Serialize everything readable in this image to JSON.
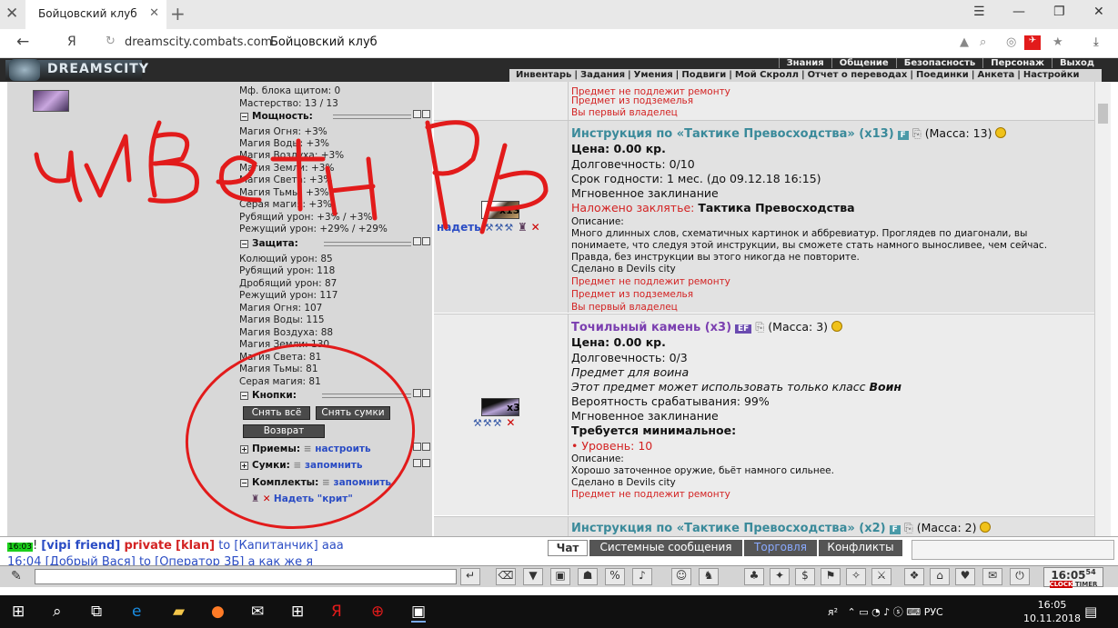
{
  "browser": {
    "tab_title": "Бойцовский клуб",
    "url_host": "dreamscity.combats.com",
    "page_title": "Бойцовский клуб",
    "yandex_letter": "Я"
  },
  "game": {
    "logo": "DREAMSCITY",
    "top_menu": [
      "Знания",
      "Общение",
      "Безопасность",
      "Персонаж",
      "Выход"
    ],
    "sub_menu": [
      "Инвентарь",
      "Задания",
      "Умения",
      "Подвиги",
      "Мой Скролл",
      "Отчет о переводах",
      "Поединки",
      "Анкета",
      "Настройки"
    ]
  },
  "left": {
    "stats_top": [
      "Мф. блока щитом: 0",
      "Мастерство: 13 / 13"
    ],
    "power_header": "Мощность:",
    "power": [
      "Магия Огня: +3%",
      "Магия Воды: +3%",
      "Магия Воздуха: +3%",
      "Магия Земли: +3%",
      "Магия Света: +3%",
      "Магия Тьмы: +3%",
      "Серая магия: +3%",
      "Рубящий урон: +3% / +3%",
      "Режущий урон: +29% / +29%"
    ],
    "defense_header": "Защита:",
    "defense": [
      "Колющий урон: 85",
      "Рубящий урон: 118",
      "Дробящий урон: 87",
      "Режущий урон: 117",
      "Магия Огня: 107",
      "Магия Воды: 115",
      "Магия Воздуха: 88",
      "Магия Земли: 130",
      "Магия Света: 81",
      "Магия Тьмы: 81",
      "Серая магия: 81"
    ],
    "buttons_header": "Кнопки:",
    "btn_remove_all": "Снять всё",
    "btn_remove_bags": "Снять сумки",
    "btn_return": "Возврат",
    "techniques": "Приемы:",
    "bags": "Сумки:",
    "sets": "Комплекты:",
    "configure": "настроить",
    "remember": "запомнить",
    "remember2": "запомнить",
    "wear_set": "Надеть \"крит\""
  },
  "items": {
    "top_partial": [
      "Предмет не подлежит ремонту",
      "Предмет из подземелья",
      "Вы первый владелец"
    ],
    "item1": {
      "name": "Инструкция по «Тактике Превосходства» (x13)",
      "badge": "F",
      "mass": "(Масса: 13)",
      "count_label": "x13",
      "wear_link": "надеть",
      "lines": [
        "Цена: 0.00 кр.",
        "Долговечность: 0/10",
        "Срок годности: 1 мес. (до 09.12.18 16:15)",
        "Мгновенное заклинание"
      ],
      "spell_label": "Наложено заклятье:",
      "spell_value": "Тактика Превосходства",
      "desc_label": "Описание:",
      "desc": [
        "Много длинных слов, схематичных картинок и аббревиатур. Проглядев по диагонали, вы",
        "понимаете, что следуя этой инструкции, вы сможете стать намного выносливее, чем сейчас.",
        "Правда, без инструкции вы этого никогда не повторите."
      ],
      "made_in": "Сделано в Devils city",
      "red": [
        "Предмет не подлежит ремонту",
        "Предмет из подземелья",
        "Вы первый владелец"
      ]
    },
    "item2": {
      "name": "Точильный камень (x3)",
      "badge": "EF",
      "mass": "(Масса: 3)",
      "count_label": "x3",
      "lines": [
        "Цена: 0.00 кр.",
        "Долговечность: 0/3"
      ],
      "for_warrior": "Предмет для воина",
      "class_only": "Этот предмет может использовать только класс",
      "class_name": "Воин",
      "chance": "Вероятность срабатывания: 99%",
      "instant": "Мгновенное заклинание",
      "req_label": "Требуется минимальное:",
      "req_level": "• Уровень: 10",
      "desc_label": "Описание:",
      "desc": "Хорошо заточенное оружие, бьёт намного сильнее.",
      "made_in": "Сделано в Devils city",
      "red": "Предмет не подлежит ремонту"
    },
    "item3": {
      "name": "Инструкция по «Тактике Превосходства» (x2)",
      "badge": "F",
      "mass": "(Масса: 2)"
    }
  },
  "chat": {
    "time": "16:03",
    "bang": "!",
    "user1": "[vipi friend]",
    "private": "private",
    "klan": "[klan]",
    "to": "to",
    "target": "[Капитанчик]",
    "msg": "aaa",
    "line2": "16:04 [Добрый Вася] to [Оператор 3Б] а как же я",
    "tabs": [
      "Чат",
      "Системные сообщения",
      "Торговля",
      "Конфликты"
    ],
    "clock": "16:05",
    "clock_sec": "54",
    "clock_label": "CLOCK",
    "timer_label": "TIMER"
  },
  "taskbar": {
    "lang": "РУС",
    "time": "16:05",
    "date": "10.11.2018"
  },
  "scribble_text": "чиветнрь",
  "colors": {
    "accent_red": "#e21b1b",
    "link_blue": "#2a4cc4",
    "item_teal": "#3a8a9a",
    "item_purple": "#7b3fb0"
  }
}
